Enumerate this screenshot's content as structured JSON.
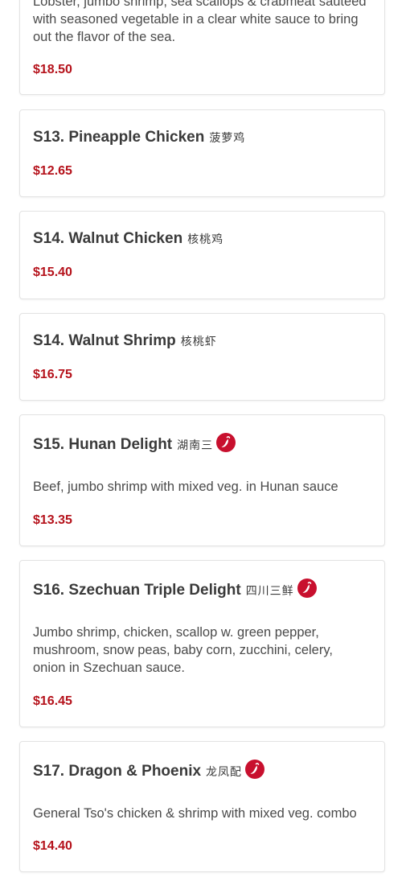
{
  "items": [
    {
      "id": "s12",
      "name": "",
      "chinese": "",
      "spicy": false,
      "description": "Lobster, jumbo shrimp, sea scallops & crabmeat sauteed with seasoned vegetable in a clear white sauce to bring out the flavor of the sea.",
      "price": "$18.50"
    },
    {
      "id": "s13",
      "name": "S13. Pineapple Chicken",
      "chinese": "菠萝鸡",
      "spicy": false,
      "description": "",
      "price": "$12.65"
    },
    {
      "id": "s14a",
      "name": "S14. Walnut Chicken",
      "chinese": "核桃鸡",
      "spicy": false,
      "description": "",
      "price": "$15.40"
    },
    {
      "id": "s14b",
      "name": "S14. Walnut Shrimp",
      "chinese": "核桃虾",
      "spicy": false,
      "description": "",
      "price": "$16.75"
    },
    {
      "id": "s15",
      "name": "S15. Hunan Delight",
      "chinese": "湖南三",
      "spicy": true,
      "description": "Beef, jumbo shrimp with mixed veg. in Hunan sauce",
      "price": "$13.35"
    },
    {
      "id": "s16",
      "name": "S16. Szechuan Triple Delight",
      "chinese": "四川三鲜",
      "spicy": true,
      "description": "Jumbo shrimp, chicken, scallop w. green pepper, mushroom, snow peas, baby corn, zucchini, celery, onion in Szechuan sauce.",
      "price": "$16.45"
    },
    {
      "id": "s17",
      "name": "S17. Dragon & Phoenix",
      "chinese": "龙凤配",
      "spicy": true,
      "description": "General Tso's chicken & shrimp with mixed veg. combo",
      "price": "$14.40"
    }
  ],
  "icons": {
    "spicy": "chili-pepper-icon"
  },
  "colors": {
    "price": "#b5121b",
    "spicy_badge": "#c8102e",
    "border": "#e3e3e3"
  }
}
